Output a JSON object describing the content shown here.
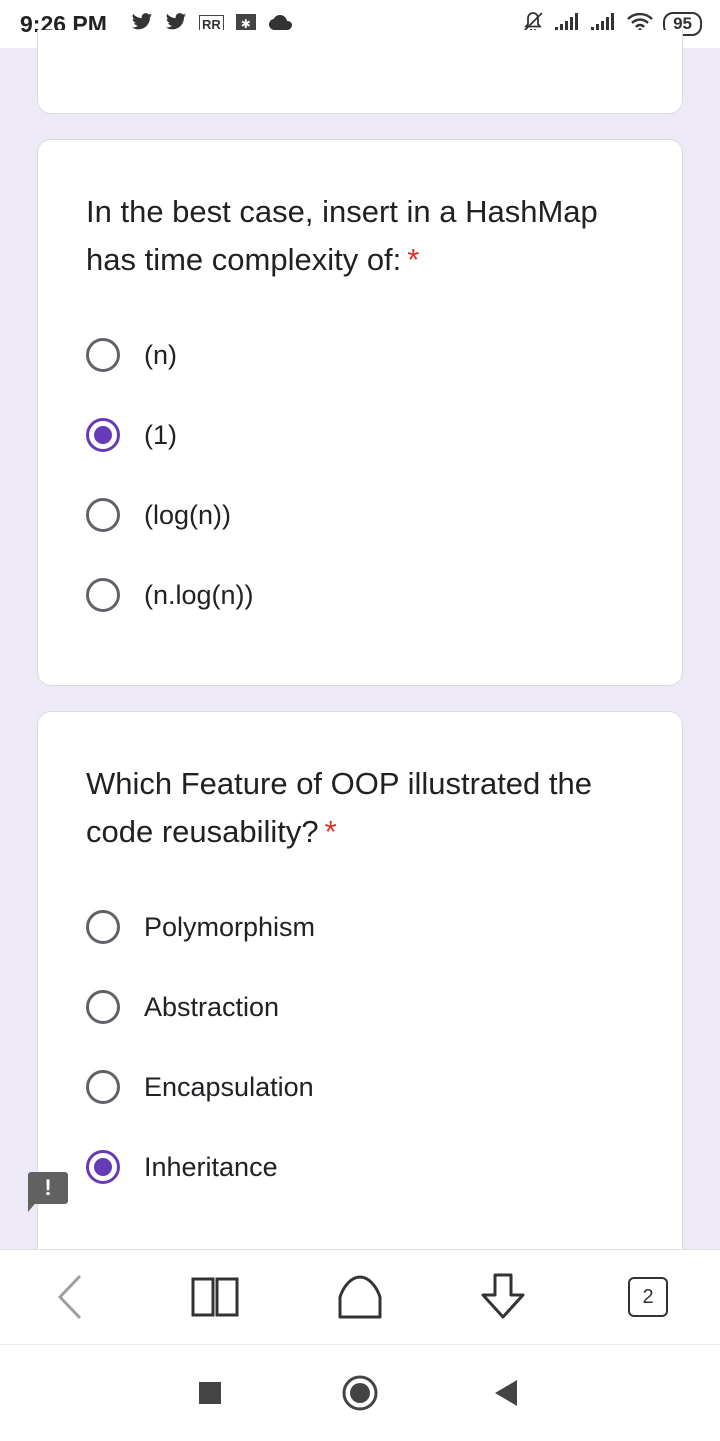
{
  "status_bar": {
    "time": "9:26 PM",
    "left_icons": [
      "twitter-icon",
      "twitter-icon",
      "rr-app-icon",
      "gallery-icon",
      "cloud-icon"
    ],
    "right_icons": [
      "bell-off-icon",
      "signal-icon",
      "signal-icon",
      "wifi-icon"
    ],
    "battery": "95"
  },
  "form": {
    "questions": [
      {
        "text": "In the best case, insert in a HashMap has time complexity of:",
        "required_mark": "*",
        "options": [
          {
            "label": "(n)",
            "selected": false
          },
          {
            "label": "(1)",
            "selected": true
          },
          {
            "label": "(log(n))",
            "selected": false
          },
          {
            "label": "(n.log(n))",
            "selected": false
          }
        ]
      },
      {
        "text": "Which Feature of OOP illustrated the code reusability?",
        "required_mark": "*",
        "options": [
          {
            "label": "Polymorphism",
            "selected": false
          },
          {
            "label": "Abstraction",
            "selected": false
          },
          {
            "label": "Encapsulation",
            "selected": false
          },
          {
            "label": "Inheritance",
            "selected": true
          }
        ]
      }
    ]
  },
  "feedback_badge": "!",
  "browser_toolbar": {
    "buttons": [
      "back-icon",
      "bookmarks-icon",
      "home-icon",
      "download-icon",
      "tabs-icon"
    ],
    "tab_count": "2"
  },
  "colors": {
    "accent": "#673ab7",
    "required": "#d93025",
    "background": "#ede9f7"
  }
}
